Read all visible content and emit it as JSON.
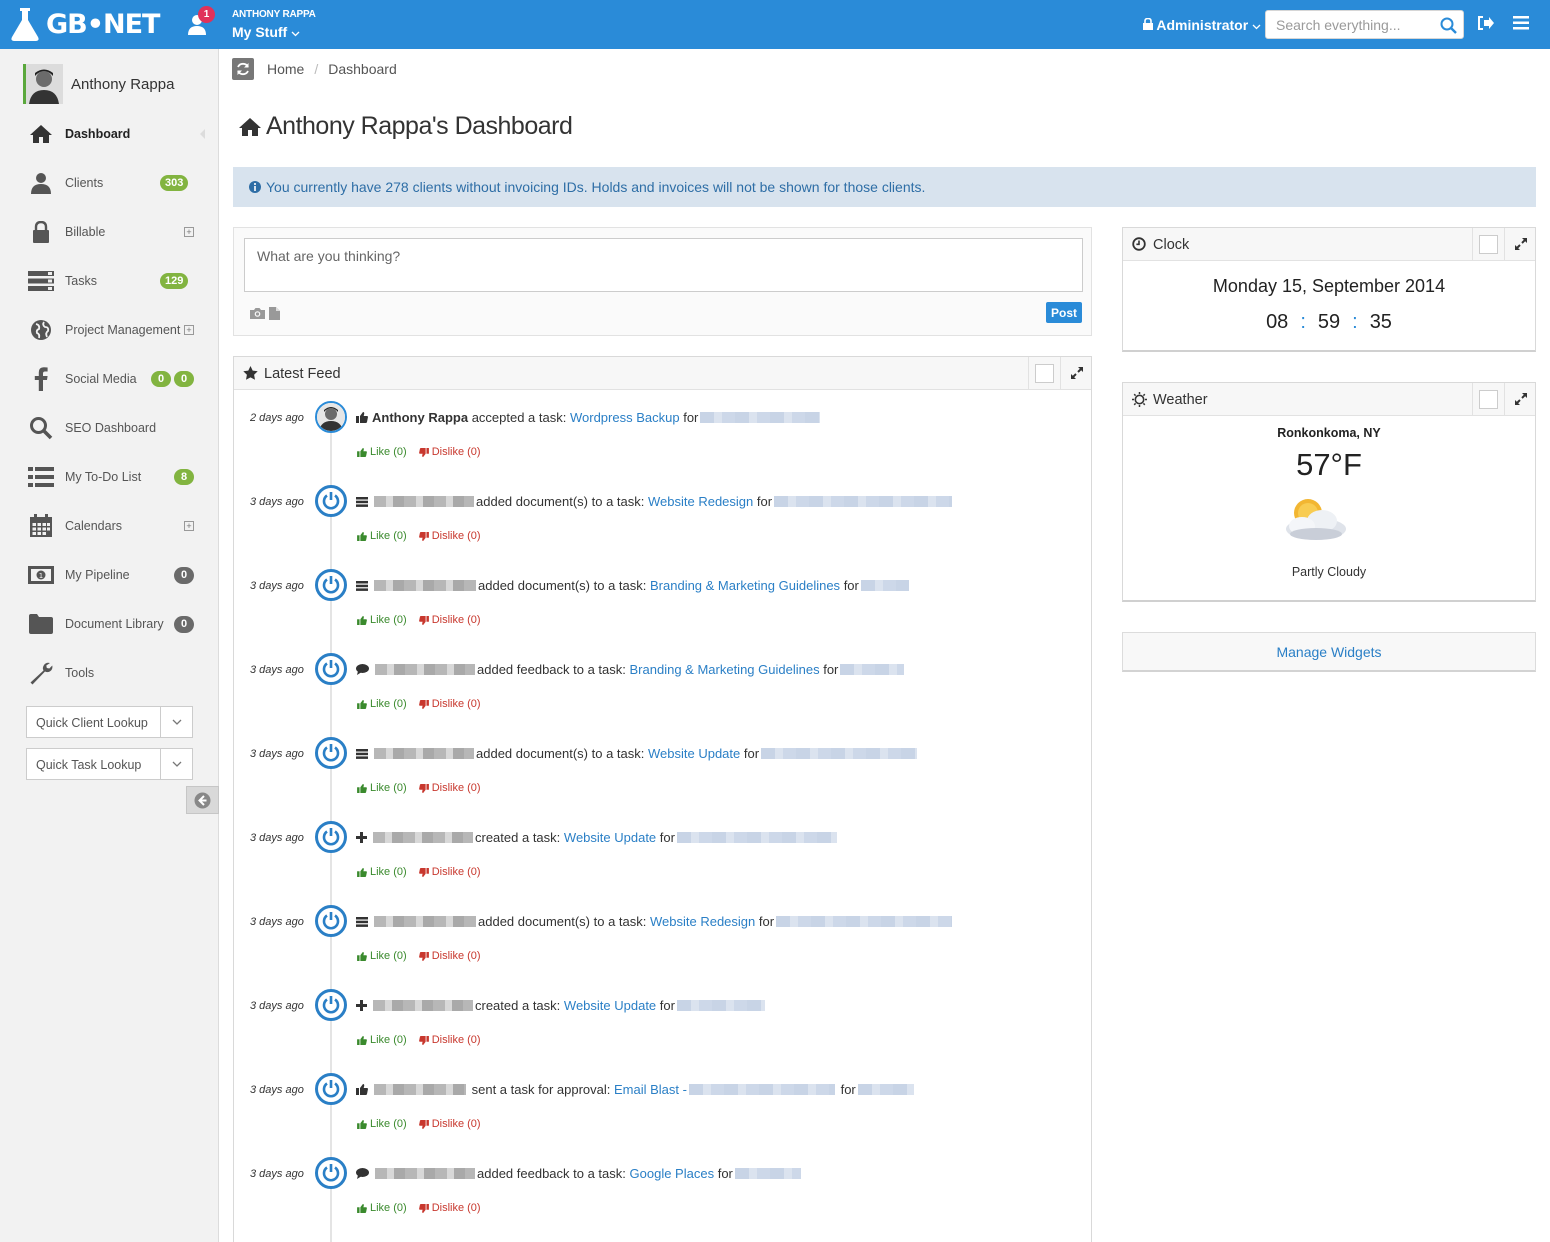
{
  "topbar": {
    "logo_text": "GB•NET",
    "notifications_count": "1",
    "username": "ANTHONY RAPPA",
    "my_stuff_label": "My Stuff",
    "role_label": "Administrator",
    "search_placeholder": "Search everything...",
    "brand_color": "#2a8bd8"
  },
  "sidebar": {
    "profile_name": "Anthony Rappa",
    "items": [
      {
        "label": "Dashboard",
        "icon": "home-icon"
      },
      {
        "label": "Clients",
        "icon": "user-icon",
        "badge": "303"
      },
      {
        "label": "Billable",
        "icon": "lock-icon"
      },
      {
        "label": "Tasks",
        "icon": "tasks-icon",
        "badge": "129"
      },
      {
        "label": "Project Management",
        "icon": "globe-icon"
      },
      {
        "label": "Social Media",
        "icon": "facebook-icon",
        "badge_a": "0",
        "badge_b": "0"
      },
      {
        "label": "SEO Dashboard",
        "icon": "search-icon"
      },
      {
        "label": "My To-Do List",
        "icon": "list-icon",
        "badge": "8"
      },
      {
        "label": "Calendars",
        "icon": "calendar-icon"
      },
      {
        "label": "My Pipeline",
        "icon": "money-icon",
        "badge": "0"
      },
      {
        "label": "Document Library",
        "icon": "folder-icon",
        "badge": "0"
      },
      {
        "label": "Tools",
        "icon": "wrench-icon"
      }
    ],
    "quick_client_lookup": "Quick Client Lookup",
    "quick_task_lookup": "Quick Task Lookup"
  },
  "breadcrumb": {
    "home": "Home",
    "current": "Dashboard"
  },
  "page_title": "Anthony Rappa's Dashboard",
  "alert_text": "You currently have 278 clients without invoicing IDs. Holds and invoices will not be shown for those clients.",
  "post": {
    "placeholder": "What are you thinking?",
    "button": "Post"
  },
  "feed": {
    "title": "Latest Feed",
    "like_label": "Like (0)",
    "dislike_label": "Dislike (0)",
    "items": [
      {
        "time": "2 days ago",
        "actor": "Anthony Rappa",
        "action": "accepted a task:",
        "task": "Wordpress Backup",
        "for": "for"
      },
      {
        "time": "3 days ago",
        "action": "added document(s) to a task:",
        "task": "Website Redesign",
        "for": "for"
      },
      {
        "time": "3 days ago",
        "action": "added document(s) to a task:",
        "task": "Branding & Marketing Guidelines",
        "for": "for"
      },
      {
        "time": "3 days ago",
        "action": "added feedback to a task:",
        "task": "Branding & Marketing Guidelines",
        "for": "for"
      },
      {
        "time": "3 days ago",
        "action": "added document(s) to a task:",
        "task": "Website Update",
        "for": "for"
      },
      {
        "time": "3 days ago",
        "action": "created a task:",
        "task": "Website Update",
        "for": "for"
      },
      {
        "time": "3 days ago",
        "action": "added document(s) to a task:",
        "task": "Website Redesign",
        "for": "for"
      },
      {
        "time": "3 days ago",
        "action": "created a task:",
        "task": "Website Update",
        "for": "for"
      },
      {
        "time": "3 days ago",
        "action": "sent a task for approval:",
        "task": "Email Blast -",
        "for": "for"
      },
      {
        "time": "3 days ago",
        "action": "added feedback to a task:",
        "task": "Google Places",
        "for": "for"
      }
    ]
  },
  "clock": {
    "title": "Clock",
    "date": "Monday 15, September 2014",
    "hours": "08",
    "minutes": "59",
    "seconds": "35",
    "separator": ":"
  },
  "weather": {
    "title": "Weather",
    "city": "Ronkonkoma, NY",
    "temp": "57°F",
    "condition": "Partly Cloudy"
  },
  "manage_widgets": "Manage Widgets"
}
